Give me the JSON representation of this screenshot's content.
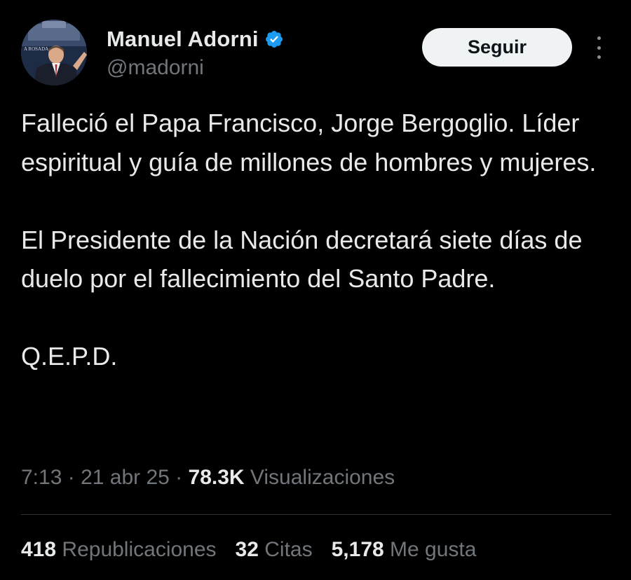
{
  "author": {
    "display_name": "Manuel Adorni",
    "handle": "@madorni",
    "verified_icon": "verified-badge-icon",
    "avatar_sign_text": "A ROSADA"
  },
  "actions": {
    "follow_label": "Seguir",
    "more_icon": "more-options-icon"
  },
  "tweet": {
    "paragraphs": [
      "Falleció el Papa Francisco, Jorge Bergoglio. Líder espiritual y guía de millones de hombres y mujeres.",
      "El Presidente de la Nación decretará siete días de duelo por el fallecimiento del Santo Padre.",
      "Q.E.P.D."
    ],
    "time": "7:13",
    "date": "21 abr 25",
    "separator": " · ",
    "views_count": "78.3K",
    "views_label": "Visualizaciones"
  },
  "stats": {
    "reposts_count": "418",
    "reposts_label": "Republicaciones",
    "quotes_count": "32",
    "quotes_label": "Citas",
    "likes_count": "5,178",
    "likes_label": "Me gusta"
  },
  "colors": {
    "background": "#000000",
    "primary_text": "#e7e9ea",
    "secondary_text": "#71767b",
    "verified_blue": "#1d9bf0",
    "button_bg": "#eff3f4"
  }
}
